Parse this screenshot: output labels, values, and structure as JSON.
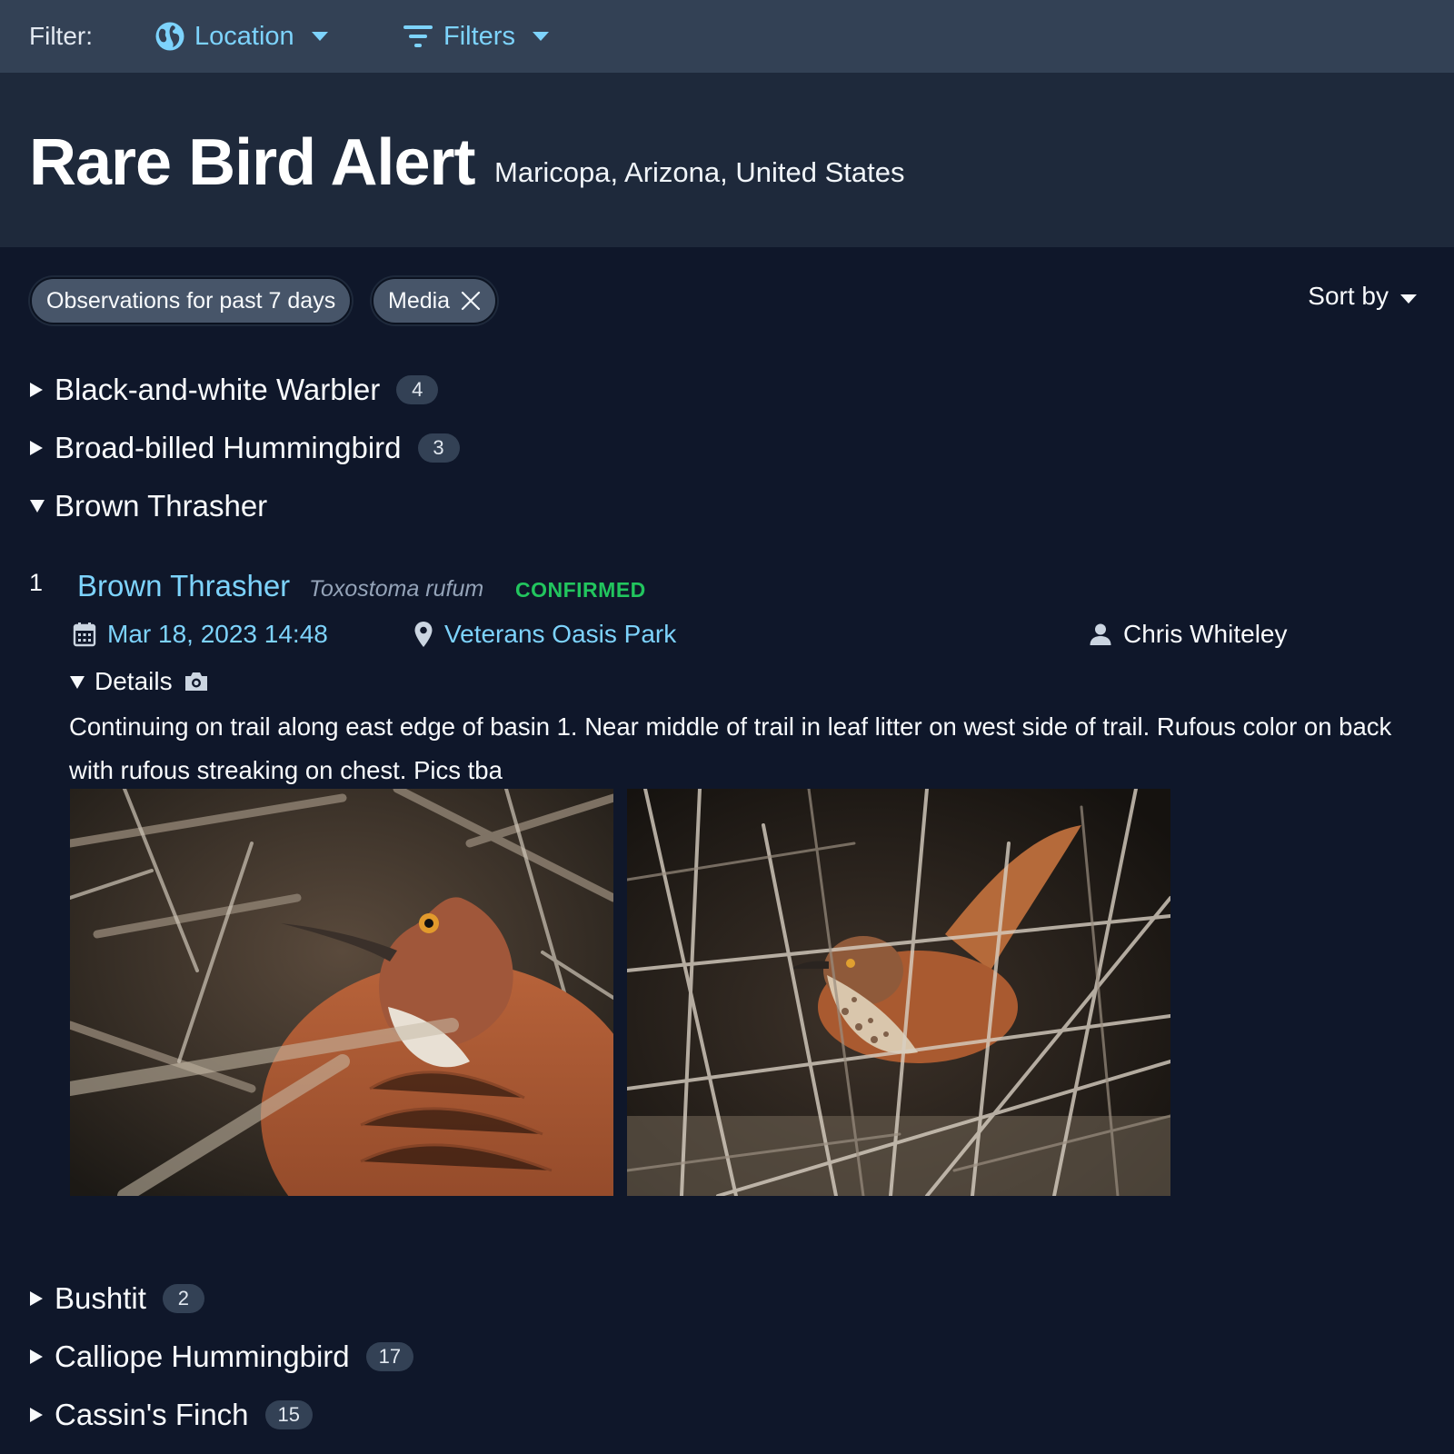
{
  "filter_bar": {
    "label": "Filter:",
    "location_label": "Location",
    "filters_label": "Filters"
  },
  "header": {
    "title": "Rare Bird Alert",
    "region": "Maricopa, Arizona, United States"
  },
  "chips": {
    "period": "Observations for past 7 days",
    "media": "Media"
  },
  "sort": {
    "label": "Sort by"
  },
  "species_before": [
    {
      "name": "Black-and-white Warbler",
      "count": "4"
    },
    {
      "name": "Broad-billed Hummingbird",
      "count": "3"
    }
  ],
  "expanded_species": {
    "name": "Brown Thrasher",
    "observation": {
      "index": "1",
      "common_name": "Brown Thrasher",
      "scientific_name": "Toxostoma rufum",
      "status": "CONFIRMED",
      "datetime": "Mar 18, 2023 14:48",
      "location": "Veterans Oasis Park",
      "observer": "Chris Whiteley",
      "details_label": "Details",
      "comments": "Continuing on trail along east edge of basin 1. Near middle of trail in leaf litter on west side of trail. Rufous color on back with rufous streaking on chest. Pics tba"
    }
  },
  "species_after": [
    {
      "name": "Bushtit",
      "count": "2"
    },
    {
      "name": "Calliope Hummingbird",
      "count": "17"
    },
    {
      "name": "Cassin's Finch",
      "count": "15"
    }
  ],
  "icons": {
    "location": "globe-icon",
    "filters": "filter-lines-icon",
    "dropdown": "caret-down-icon",
    "collapsed": "triangle-right-icon",
    "expanded": "triangle-down-icon",
    "remove_chip": "close-icon",
    "date": "calendar-icon",
    "place": "map-pin-icon",
    "observer": "user-icon",
    "media": "camera-icon"
  },
  "colors": {
    "background": "#0f172a",
    "topbar": "#334155",
    "header": "#1e293b",
    "link": "#7dd3fc",
    "confirmed": "#22c55e",
    "badge": "#334155"
  }
}
